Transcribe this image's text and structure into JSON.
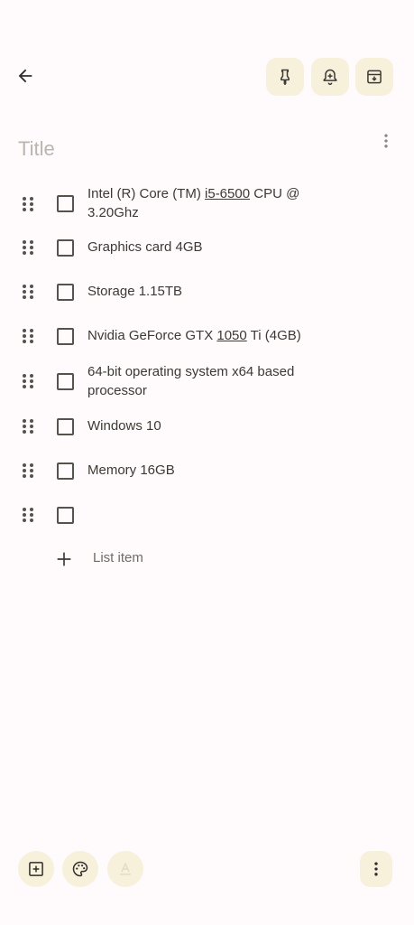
{
  "header": {
    "back_icon": "arrow-left-icon",
    "actions": [
      {
        "name": "pin",
        "icon": "pin-icon"
      },
      {
        "name": "reminder",
        "icon": "bell-plus-icon"
      },
      {
        "name": "archive",
        "icon": "archive-icon"
      }
    ]
  },
  "note": {
    "title_value": "",
    "title_placeholder": "Title",
    "more_icon": "more-vertical-icon"
  },
  "checklist": {
    "items": [
      {
        "pre": "Intel (R) Core (TM) ",
        "ul": "i5-6500",
        "post": " CPU @",
        "line2": "3.20Ghz",
        "checked": false
      },
      {
        "text": "Graphics card 4GB",
        "checked": false
      },
      {
        "text": "Storage 1.15TB",
        "checked": false
      },
      {
        "pre": "Nvidia GeForce GTX ",
        "ul": "1050",
        "post": " Ti (4GB)",
        "checked": false
      },
      {
        "text": "64-bit operating system x64 based",
        "line2": "processor",
        "checked": false
      },
      {
        "text": "Windows 10",
        "checked": false
      },
      {
        "text": "Memory 16GB",
        "checked": false
      },
      {
        "text": "",
        "checked": false
      }
    ],
    "add_label": "List item"
  },
  "bottom": {
    "icons": [
      "add-box-icon",
      "palette-icon",
      "text-format-icon"
    ],
    "more_icon": "more-vertical-icon"
  },
  "colors": {
    "background": "#fffafb",
    "chip": "#f7f1dc",
    "text": "#3b3a36",
    "placeholder": "#b9b6b0"
  }
}
